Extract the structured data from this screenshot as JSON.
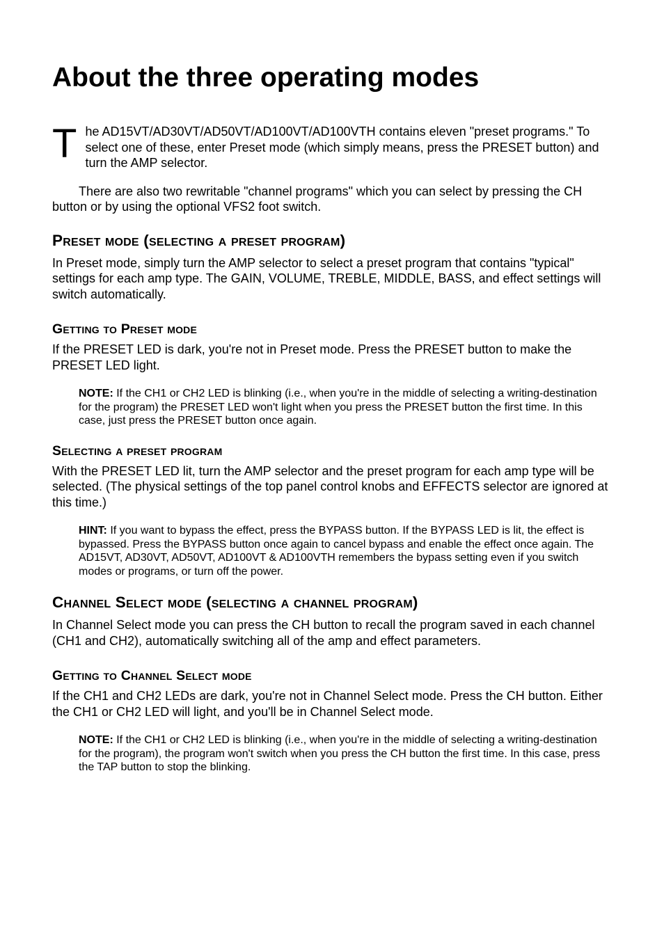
{
  "title": "About the three operating modes",
  "intro": {
    "dropcap": "T",
    "para1": "he AD15VT/AD30VT/AD50VT/AD100VT/AD100VTH contains eleven \"preset programs.\" To select one of these, enter Preset mode (which simply means, press the PRESET button) and turn the AMP selector.",
    "para2": "There are also two rewritable \"channel programs\" which you can select by pressing the CH button or by using the optional VFS2 foot switch."
  },
  "preset_mode": {
    "heading": "Preset mode (selecting a preset program)",
    "body": "In Preset mode, simply turn the AMP selector to select a preset program that contains \"typical\" settings for each amp type. The GAIN, VOLUME, TREBLE, MIDDLE, BASS, and effect settings will switch automatically.",
    "getting_to": {
      "heading": "Getting to Preset mode",
      "body": "If the PRESET LED is dark, you're not in Preset mode. Press the PRESET button to make the PRESET LED light.",
      "note_label": "NOTE:",
      "note": " If the CH1 or CH2 LED is blinking (i.e., when you're in the middle of selecting a writing-destination for the program) the PRESET LED won't light when you press the PRESET button the first time. In this case, just press the PRESET button once again."
    },
    "selecting": {
      "heading": "Selecting a preset program",
      "body": "With the PRESET LED lit, turn the AMP selector and the preset program for each amp type will be selected. (The physical settings of the top panel control knobs and EFFECTS selector are ignored at this time.)",
      "hint_label": "HINT:",
      "hint": " If you want to bypass the effect, press the BYPASS button. If the BYPASS LED is lit, the effect is bypassed. Press the BYPASS button once again to cancel bypass and enable the effect once again. The AD15VT, AD30VT, AD50VT, AD100VT & AD100VTH remembers the bypass setting even if you switch modes or programs, or turn off the power."
    }
  },
  "channel_mode": {
    "heading": "Channel Select mode (selecting a channel program)",
    "body": "In Channel Select mode you can press the CH button to recall the program saved in each channel (CH1 and CH2), automatically switching all of the amp and effect parameters.",
    "getting_to": {
      "heading": "Getting to Channel Select mode",
      "body": "If the CH1 and CH2 LEDs are dark, you're not in Channel Select mode. Press the CH button. Either the CH1 or CH2 LED will light, and you'll be in Channel Select mode.",
      "note_label": "NOTE:",
      "note": " If the CH1 or CH2 LED is blinking (i.e., when you're in the middle of selecting a writing-destination for the program), the program won't switch when you press the CH button the first time. In this case, press the TAP button to stop the blinking."
    }
  }
}
